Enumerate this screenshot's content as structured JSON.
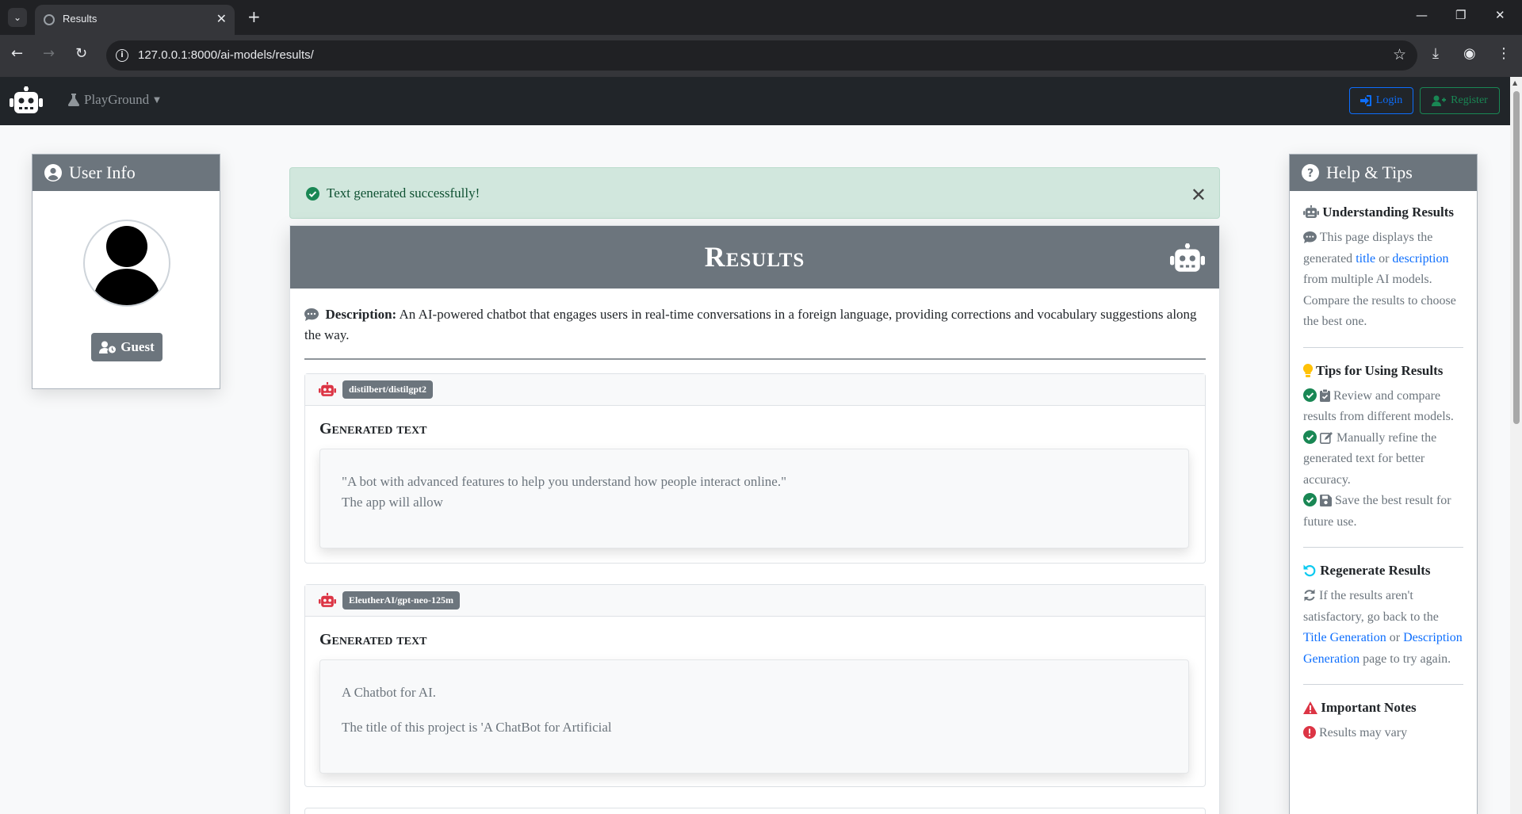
{
  "browser": {
    "tab_title": "Results",
    "url": "127.0.0.1:8000/ai-models/results/"
  },
  "navbar": {
    "playground_label": "PlayGround",
    "login_label": "Login",
    "register_label": "Register"
  },
  "user_info": {
    "title": "User Info",
    "guest_label": "Guest"
  },
  "alert": {
    "message": "Text generated successfully!"
  },
  "results": {
    "title": "Results",
    "description_label": "Description:",
    "description_text": "An AI-powered chatbot that engages users in real-time conversations in a foreign language, providing corrections and vocabulary suggestions along the way.",
    "models": [
      {
        "name": "distilbert/distilgpt2",
        "heading": "Generated text",
        "lines": [
          "\"A bot with advanced features to help you understand how people interact online.\"",
          "The app will allow"
        ]
      },
      {
        "name": "EleutherAI/gpt-neo-125m",
        "heading": "Generated text",
        "paragraphs": [
          "A Chatbot for AI.",
          "The title of this project is 'A ChatBot for Artificial"
        ]
      }
    ]
  },
  "help": {
    "title": "Help & Tips",
    "understanding": {
      "heading": "Understanding Results",
      "text_1": "This page displays the generated",
      "link_title": "title",
      "text_or": "or",
      "link_description": "description",
      "text_2": "from multiple AI models. Compare the results to choose the best one."
    },
    "tips": {
      "heading": "Tips for Using Results",
      "items": [
        "Review and compare results from different models.",
        "Manually refine the generated text for better accuracy.",
        "Save the best result for future use."
      ]
    },
    "regenerate": {
      "heading": "Regenerate Results",
      "text_1": "If the results aren't satisfactory, go back to the",
      "link_title_gen": "Title Generation",
      "text_or": "or",
      "link_desc_gen": "Description Generation",
      "text_2": "page to try again."
    },
    "notes": {
      "heading": "Important Notes",
      "text": "Results may vary"
    }
  },
  "colors": {
    "navbar_bg": "#212529",
    "header_gray": "#6c757d",
    "alert_bg": "#d1e7dd",
    "success": "#198754",
    "primary": "#0d6efd",
    "danger": "#dc3545",
    "info": "#0dcaf0",
    "warning": "#ffc107"
  }
}
